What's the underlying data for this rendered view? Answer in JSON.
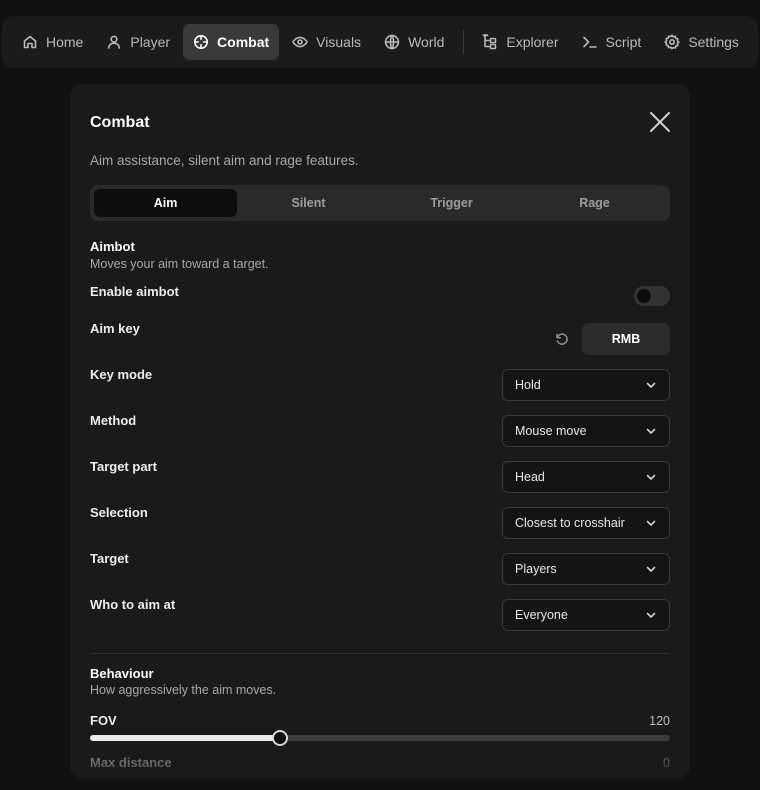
{
  "nav": {
    "items": [
      {
        "label": "Home",
        "icon": "home-icon"
      },
      {
        "label": "Player",
        "icon": "user-icon"
      },
      {
        "label": "Combat",
        "icon": "crosshair-icon",
        "active": true
      },
      {
        "label": "Visuals",
        "icon": "eye-icon"
      },
      {
        "label": "World",
        "icon": "globe-icon"
      },
      {
        "label": "Explorer",
        "icon": "tree-icon"
      },
      {
        "label": "Script",
        "icon": "terminal-icon"
      },
      {
        "label": "Settings",
        "icon": "gear-icon"
      }
    ]
  },
  "panel": {
    "title": "Combat",
    "description": "Aim assistance, silent aim and rage features.",
    "tabs": [
      {
        "label": "Aim",
        "active": true
      },
      {
        "label": "Silent"
      },
      {
        "label": "Trigger"
      },
      {
        "label": "Rage"
      }
    ],
    "aimbot": {
      "title": "Aimbot",
      "subtitle": "Moves your aim toward a target.",
      "enable_label": "Enable aimbot",
      "enabled": false,
      "aim_key_label": "Aim key",
      "aim_key_value": "RMB",
      "dropdowns": [
        {
          "label": "Key mode",
          "value": "Hold"
        },
        {
          "label": "Method",
          "value": "Mouse move"
        },
        {
          "label": "Target part",
          "value": "Head"
        },
        {
          "label": "Selection",
          "value": "Closest to crosshair"
        },
        {
          "label": "Target",
          "value": "Players"
        },
        {
          "label": "Who to aim at",
          "value": "Everyone"
        }
      ]
    },
    "behaviour": {
      "title": "Behaviour",
      "subtitle": "How aggressively the aim moves.",
      "sliders": [
        {
          "label": "FOV",
          "value": "120",
          "fraction": 0.328
        },
        {
          "label": "Max distance",
          "value": "0"
        }
      ]
    }
  },
  "colors": {
    "background": "#111111",
    "panel": "#1a1a1a",
    "accent": "#ffffff"
  }
}
